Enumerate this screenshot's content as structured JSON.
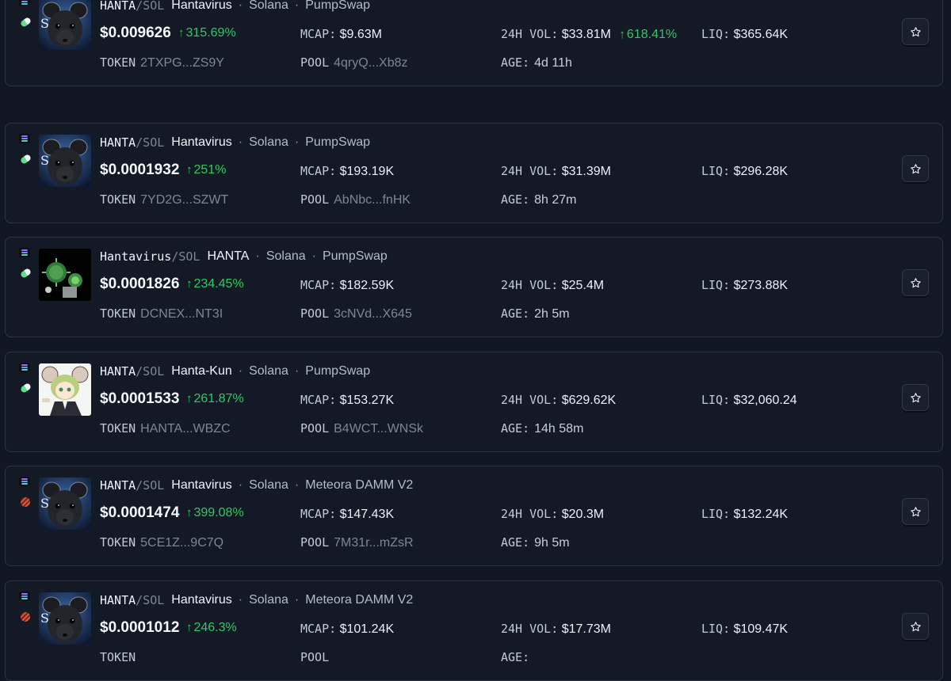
{
  "quote_symbol": "SOL",
  "colors": {
    "background": "#111722",
    "card": "#131a26",
    "positive": "#2fc866",
    "muted": "#7d8696"
  },
  "labels": {
    "mcap": "MCAP:",
    "vol": "24H VOL:",
    "liq": "LIQ:",
    "token": "TOKEN",
    "pool": "POOL",
    "age": "AGE:"
  },
  "pairs": [
    {
      "symbol": "HANTA",
      "quote": "/SOL",
      "name": "Hantavirus",
      "chain": "Solana",
      "dex": "PumpSwap",
      "dex_icon": "pumpswap-pill-icon",
      "avatar": "rat-avatar",
      "price": "$0.009626",
      "change": "315.69%",
      "mcap": "$9.63M",
      "volume": "$33.81M",
      "volume_change": "618.41%",
      "liquidity": "$365.64K",
      "token": "2TXPG...ZS9Y",
      "pool": "4qryQ...Xb8z",
      "age": "4d 11h"
    },
    {
      "symbol": "HANTA",
      "quote": "/SOL",
      "name": "Hantavirus",
      "chain": "Solana",
      "dex": "PumpSwap",
      "dex_icon": "pumpswap-pill-icon",
      "avatar": "rat-avatar",
      "price": "$0.0001932",
      "change": "251%",
      "mcap": "$193.19K",
      "volume": "$31.39M",
      "volume_change": "",
      "liquidity": "$296.28K",
      "token": "7YD2G...SZWT",
      "pool": "AbNbc...fnHK",
      "age": "8h 27m"
    },
    {
      "symbol": "Hantavirus",
      "quote": "/SOL",
      "name": "HANTA",
      "chain": "Solana",
      "dex": "PumpSwap",
      "dex_icon": "pumpswap-pill-icon",
      "avatar": "virus-avatar",
      "price": "$0.0001826",
      "change": "234.45%",
      "mcap": "$182.59K",
      "volume": "$25.4M",
      "volume_change": "",
      "liquidity": "$273.88K",
      "token": "DCNEX...NT3I",
      "pool": "3cNVd...X645",
      "age": "2h 5m"
    },
    {
      "symbol": "HANTA",
      "quote": "/SOL",
      "name": "Hanta-Kun",
      "chain": "Solana",
      "dex": "PumpSwap",
      "dex_icon": "pumpswap-pill-icon",
      "avatar": "anime-mouse-avatar",
      "price": "$0.0001533",
      "change": "261.87%",
      "mcap": "$153.27K",
      "volume": "$629.62K",
      "volume_change": "",
      "liquidity": "$32,060.24",
      "token": "HANTA...WBZC",
      "pool": "B4WCT...WNSk",
      "age": "14h 58m"
    },
    {
      "symbol": "HANTA",
      "quote": "/SOL",
      "name": "Hantavirus",
      "chain": "Solana",
      "dex": "Meteora DAMM V2",
      "dex_icon": "meteora-icon",
      "avatar": "rat-avatar",
      "price": "$0.0001474",
      "change": "399.08%",
      "mcap": "$147.43K",
      "volume": "$20.3M",
      "volume_change": "",
      "liquidity": "$132.24K",
      "token": "5CE1Z...9C7Q",
      "pool": "7M31r...mZsR",
      "age": "9h 5m"
    },
    {
      "symbol": "HANTA",
      "quote": "/SOL",
      "name": "Hantavirus",
      "chain": "Solana",
      "dex": "Meteora DAMM V2",
      "dex_icon": "meteora-icon",
      "avatar": "rat-avatar",
      "price": "$0.0001012",
      "change": "246.3%",
      "mcap": "$101.24K",
      "volume": "$17.73M",
      "volume_change": "",
      "liquidity": "$109.47K",
      "token": "",
      "pool": "",
      "age": ""
    }
  ]
}
